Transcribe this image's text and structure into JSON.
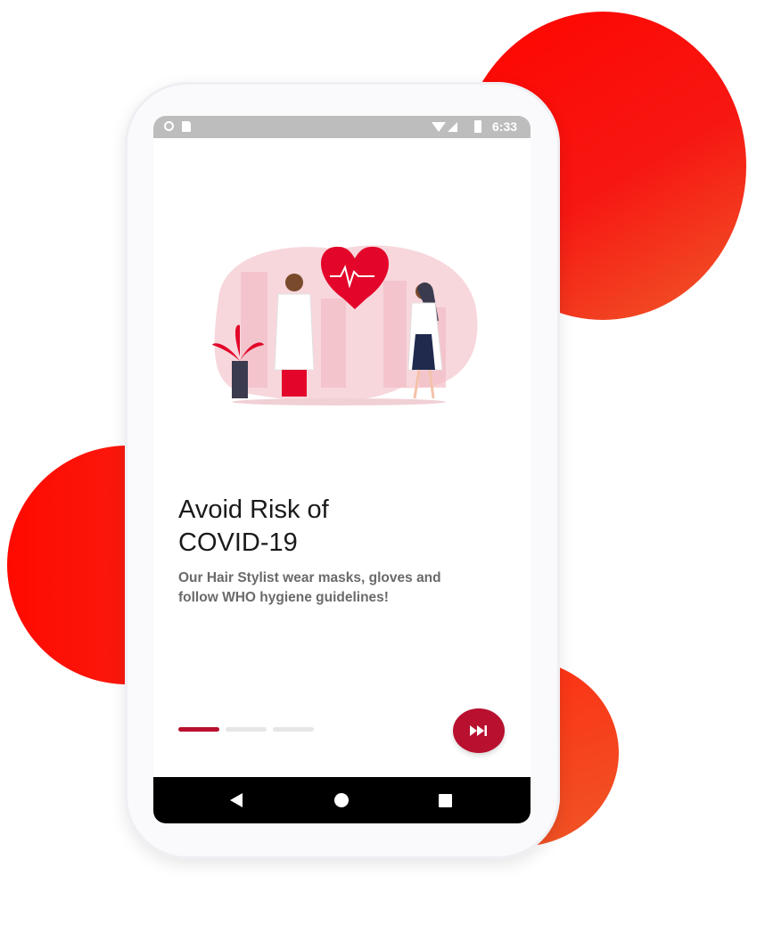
{
  "statusbar": {
    "time": "6:33",
    "icons": [
      "circle-icon",
      "sd-card-icon",
      "wifi-icon",
      "signal-icon",
      "battery-icon"
    ]
  },
  "onboarding": {
    "title_line1": "Avoid Risk of",
    "title_line2": "COVID-19",
    "description_line1": "Our Hair Stylist wear masks, gloves and",
    "description_line2": "follow WHO hygiene guidelines!",
    "illustration_icon": "doctors-heart-illustration",
    "pager": {
      "total": 3,
      "active": 1
    },
    "next_icon": "skip-next-icon"
  },
  "navbar": {
    "icons": [
      "back-triangle-icon",
      "home-circle-icon",
      "recent-square-icon"
    ]
  },
  "colors": {
    "accent": "#b8102e",
    "blob_red": "#ff0500",
    "blob_orange": "#ef5a2a",
    "title_text": "#1a1a1a",
    "desc_text": "#6a6a6a",
    "statusbar": "#bdbdbd",
    "navbar": "#000000"
  }
}
